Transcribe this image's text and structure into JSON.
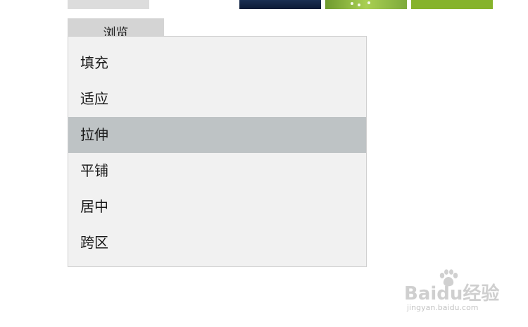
{
  "browse_button": {
    "label": "浏览"
  },
  "fit_dropdown": {
    "options": [
      "填充",
      "适应",
      "拉伸",
      "平铺",
      "居中",
      "跨区"
    ],
    "selected": "拉伸"
  },
  "watermark": {
    "brand": "Baidu经验",
    "url": "jingyan.baidu.com"
  },
  "colors": {
    "dropdown_bg": "#f1f1f1",
    "selected_bg": "#bec3c5"
  }
}
